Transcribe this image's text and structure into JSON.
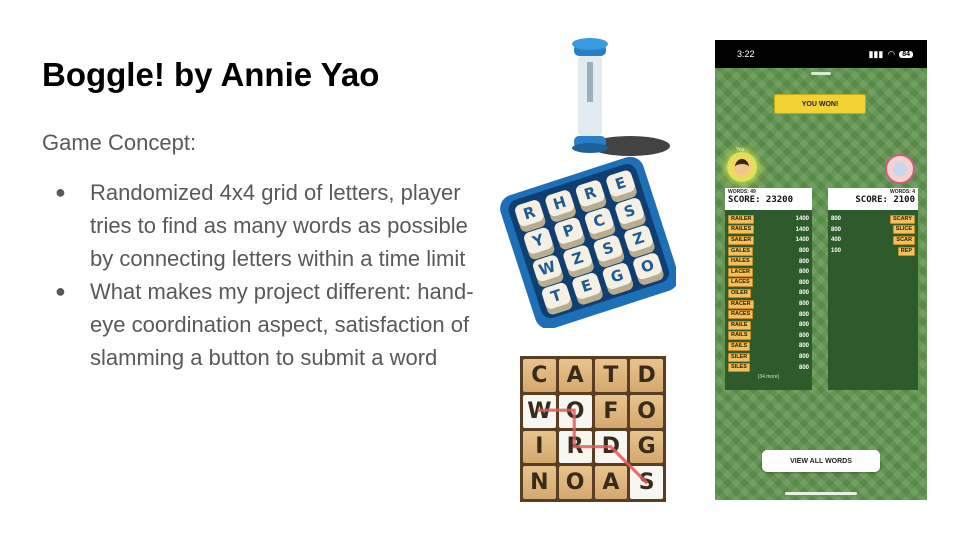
{
  "slide": {
    "title": "Boggle! by Annie Yao",
    "concept_label": "Game Concept:",
    "bullets": [
      "Randomized 4x4 grid of letters, player tries to find as many words as possible by connecting letters within a time limit",
      "What makes my project different: hand-eye coordination aspect, satisfaction of slamming a button to submit a word"
    ]
  },
  "board3d": {
    "dice": [
      "R",
      "H",
      "R",
      "E",
      "Y",
      "P",
      "C",
      "S",
      "W",
      "Z",
      "S",
      "Z",
      "T",
      "E",
      "G",
      "O"
    ]
  },
  "word_grid": {
    "letters": [
      "C",
      "A",
      "T",
      "D",
      "W",
      "O",
      "F",
      "O",
      "I",
      "R",
      "D",
      "G",
      "N",
      "O",
      "A",
      "S"
    ],
    "highlighted": [
      4,
      5,
      9,
      10,
      15
    ],
    "path_color": "#e05a5a"
  },
  "phone": {
    "status": {
      "time": "3:22",
      "battery": "84"
    },
    "banner": "YOU WON!",
    "you_label": "You",
    "player": {
      "words": "WORDS: 49",
      "score": "SCORE: 23200",
      "rows": [
        {
          "word": "RAILER",
          "pts": "1400"
        },
        {
          "word": "RAILES",
          "pts": "1400"
        },
        {
          "word": "SAILER",
          "pts": "1400"
        },
        {
          "word": "GALES",
          "pts": "800"
        },
        {
          "word": "HALES",
          "pts": "800"
        },
        {
          "word": "LACER",
          "pts": "800"
        },
        {
          "word": "LACES",
          "pts": "800"
        },
        {
          "word": "OILER",
          "pts": "800"
        },
        {
          "word": "RACER",
          "pts": "800"
        },
        {
          "word": "RACES",
          "pts": "800"
        },
        {
          "word": "RAILE",
          "pts": "800"
        },
        {
          "word": "RAILS",
          "pts": "800"
        },
        {
          "word": "SAILS",
          "pts": "800"
        },
        {
          "word": "SILER",
          "pts": "800"
        },
        {
          "word": "SILES",
          "pts": "800"
        }
      ],
      "more": "(34 more)"
    },
    "opponent": {
      "words": "WORDS: 4",
      "score": "SCORE: 2100",
      "rows": [
        {
          "word": "SCARY",
          "pts": "800"
        },
        {
          "word": "SLICE",
          "pts": "800"
        },
        {
          "word": "SCAR",
          "pts": "400"
        },
        {
          "word": "REP",
          "pts": "100"
        }
      ]
    },
    "view_all": "VIEW ALL WORDS"
  },
  "colors": {
    "text_gray": "#595959",
    "felt_green": "#5f944e",
    "banner_yellow": "#f3d334",
    "tile_orange": "#f3c05a"
  }
}
